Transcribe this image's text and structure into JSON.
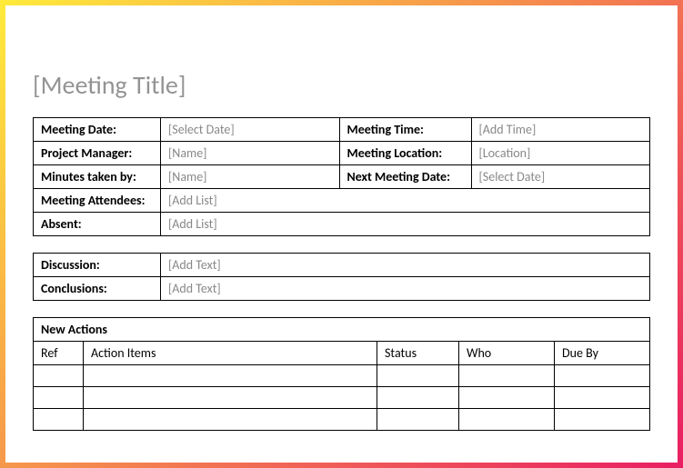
{
  "title": "[Meeting Title]",
  "info": {
    "meeting_date_label": "Meeting Date:",
    "meeting_date_value": "[Select Date]",
    "meeting_time_label": "Meeting Time:",
    "meeting_time_value": "[Add Time]",
    "project_manager_label": "Project Manager:",
    "project_manager_value": "[Name]",
    "meeting_location_label": "Meeting Location:",
    "meeting_location_value": "[Location]",
    "minutes_taken_label": "Minutes taken by:",
    "minutes_taken_value": "[Name]",
    "next_meeting_label": "Next Meeting Date:",
    "next_meeting_value": "[Select Date]",
    "attendees_label": "Meeting Attendees:",
    "attendees_value": "[Add List]",
    "absent_label": "Absent:",
    "absent_value": "[Add List]"
  },
  "notes": {
    "discussion_label": "Discussion:",
    "discussion_value": "[Add Text]",
    "conclusions_label": "Conclusions:",
    "conclusions_value": "[Add Text]"
  },
  "actions": {
    "heading": "New Actions",
    "col_ref": "Ref",
    "col_items": "Action Items",
    "col_status": "Status",
    "col_who": "Who",
    "col_due": "Due By"
  }
}
